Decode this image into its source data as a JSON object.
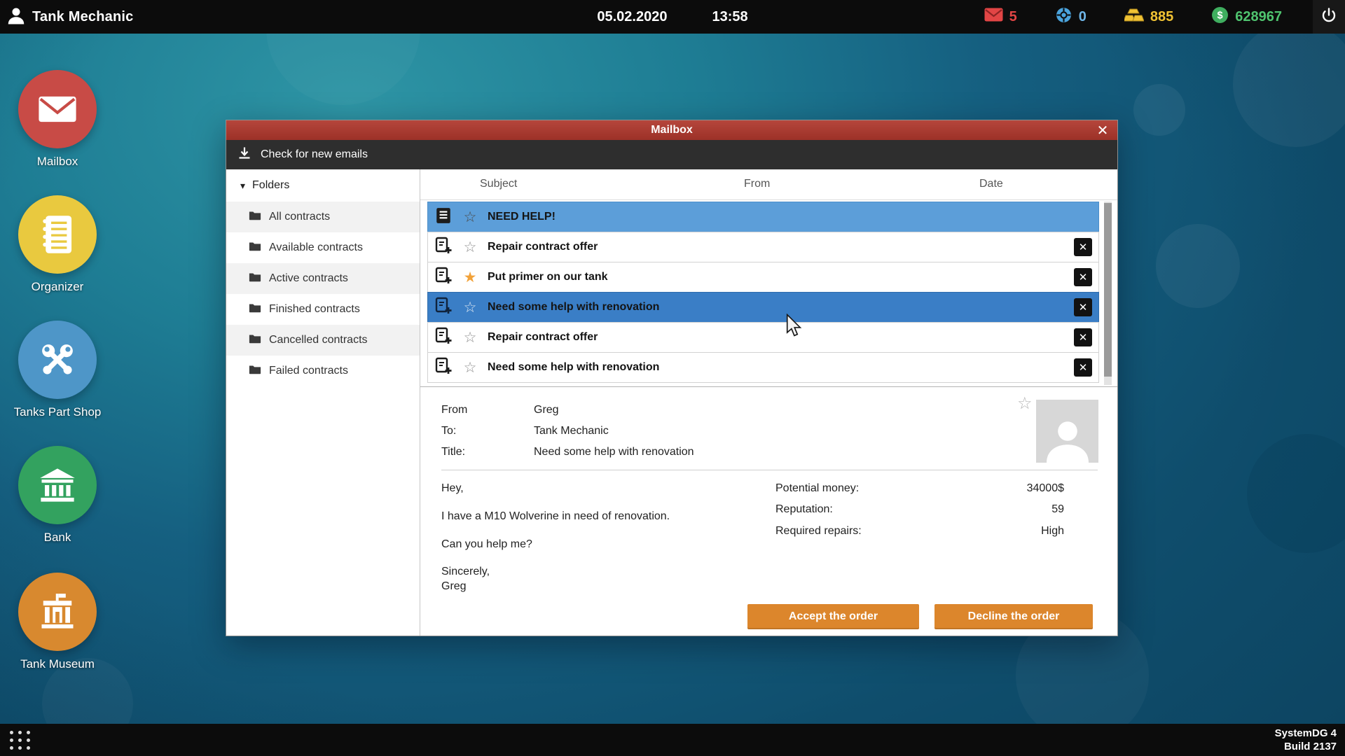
{
  "icons": {
    "close": "✕",
    "delete": "✕",
    "star_empty": "☆",
    "star_filled": "★",
    "folders_caret": "▾"
  },
  "topbar": {
    "app_title": "Tank Mechanic",
    "date": "05.02.2020",
    "time": "13:58",
    "mail_count": "5",
    "repairs_count": "0",
    "gold_amount": "885",
    "money_amount": "628967"
  },
  "desktop_icons": [
    {
      "label": "Mailbox"
    },
    {
      "label": "Organizer"
    },
    {
      "label": "Tanks Part Shop"
    },
    {
      "label": "Bank"
    },
    {
      "label": "Tank Museum"
    }
  ],
  "mailbox": {
    "window_title": "Mailbox",
    "toolbar_check_label": "Check for new emails",
    "folders_header": "Folders",
    "folders": [
      {
        "label": "All contracts"
      },
      {
        "label": "Available contracts"
      },
      {
        "label": "Active contracts"
      },
      {
        "label": "Finished contracts"
      },
      {
        "label": "Cancelled contracts"
      },
      {
        "label": "Failed contracts"
      }
    ],
    "columns": [
      {
        "label": "Subject"
      },
      {
        "label": "From"
      },
      {
        "label": "Date"
      }
    ],
    "emails": [
      {
        "subject": "NEED HELP!"
      },
      {
        "subject": "Repair contract offer"
      },
      {
        "subject": "Put primer on our tank"
      },
      {
        "subject": "Need some help with renovation"
      },
      {
        "subject": "Repair contract offer"
      },
      {
        "subject": "Need some help with renovation"
      }
    ],
    "detail": {
      "from_label": "From",
      "from_value": "Greg",
      "to_label": "To:",
      "to_value": "Tank Mechanic",
      "title_label": "Title:",
      "title_value": "Need some help with renovation",
      "body_line1": "Hey,",
      "body_line2": "I have a M10 Wolverine in need of renovation.",
      "body_line3": "Can you help me?",
      "body_line4": "Sincerely,",
      "body_line5": "Greg",
      "stats": [
        {
          "label": "Potential money:",
          "value": "34000$"
        },
        {
          "label": "Reputation:",
          "value": "59"
        },
        {
          "label": "Required repairs:",
          "value": "High"
        }
      ],
      "accept_label": "Accept the order",
      "decline_label": "Decline the order"
    }
  },
  "taskbar": {
    "system_line1": "SystemDG 4",
    "system_line2": "Build 2137"
  },
  "colors": {
    "selected_row": "#3a7ec6",
    "unread_row": "#5c9ed9",
    "accent_orange": "#dc862c",
    "titlebar_red": "#a93a30",
    "mail_badge": "#e24545",
    "gold": "#f0c233",
    "cash_green": "#4fc46f"
  }
}
